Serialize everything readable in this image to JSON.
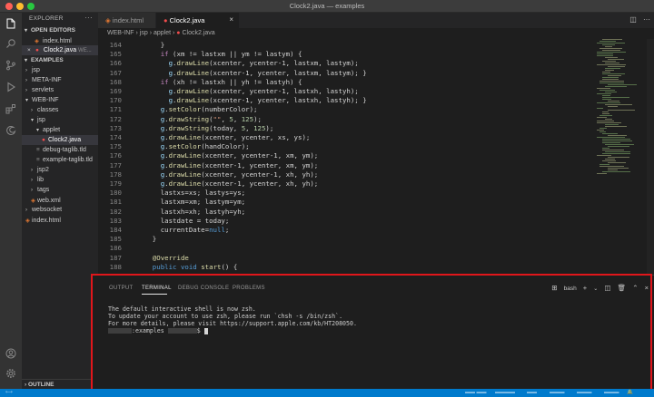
{
  "window": {
    "title": "Clock2.java — examples",
    "traffic_colors": [
      "#ff5f57",
      "#febc2e",
      "#28c840"
    ]
  },
  "sidebar": {
    "header": "EXPLORER",
    "open_editors_label": "OPEN EDITORS",
    "open_editors": [
      {
        "name": "index.html",
        "icon": "html-file-icon"
      },
      {
        "name": "Clock2.java",
        "path": "WE...",
        "icon": "java-file-icon",
        "active": true
      }
    ],
    "workspace_label": "EXAMPLES",
    "tree": [
      {
        "label": "jsp",
        "level": 1,
        "type": "folder",
        "open": false
      },
      {
        "label": "META-INF",
        "level": 1,
        "type": "folder",
        "open": false
      },
      {
        "label": "servlets",
        "level": 1,
        "type": "folder",
        "open": false
      },
      {
        "label": "WEB-INF",
        "level": 1,
        "type": "folder",
        "open": true
      },
      {
        "label": "classes",
        "level": 2,
        "type": "folder",
        "open": false
      },
      {
        "label": "jsp",
        "level": 2,
        "type": "folder",
        "open": true
      },
      {
        "label": "applet",
        "level": 3,
        "type": "folder",
        "open": true
      },
      {
        "label": "Clock2.java",
        "level": 4,
        "type": "java",
        "selected": true
      },
      {
        "label": "debug-taglib.tld",
        "level": 3,
        "type": "tld"
      },
      {
        "label": "example-taglib.tld",
        "level": 3,
        "type": "tld"
      },
      {
        "label": "jsp2",
        "level": 2,
        "type": "folder",
        "open": false
      },
      {
        "label": "lib",
        "level": 2,
        "type": "folder",
        "open": false
      },
      {
        "label": "tags",
        "level": 2,
        "type": "folder",
        "open": false
      },
      {
        "label": "web.xml",
        "level": 2,
        "type": "xml"
      },
      {
        "label": "websocket",
        "level": 1,
        "type": "folder",
        "open": false
      },
      {
        "label": "index.html",
        "level": 1,
        "type": "html"
      }
    ],
    "outline_label": "OUTLINE"
  },
  "tabs": [
    {
      "label": "index.html",
      "icon": "html-file-icon",
      "active": false
    },
    {
      "label": "Clock2.java",
      "icon": "java-file-icon",
      "active": true
    }
  ],
  "breadcrumb": [
    "WEB-INF",
    "jsp",
    "applet",
    "Clock2.java"
  ],
  "editor": {
    "lines": [
      {
        "n": "164",
        "indent": 6,
        "tokens": [
          [
            "p",
            "}"
          ]
        ]
      },
      {
        "n": "165",
        "indent": 6,
        "tokens": [
          [
            "kw",
            "if"
          ],
          [
            "p",
            " (xm != lastxm || ym != lastym) {"
          ]
        ]
      },
      {
        "n": "166",
        "indent": 8,
        "tokens": [
          [
            "v",
            "g"
          ],
          [
            "p",
            "."
          ],
          [
            "fn",
            "drawLine"
          ],
          [
            "p",
            "(xcenter, ycenter-1, lastxm, lastym);"
          ]
        ]
      },
      {
        "n": "167",
        "indent": 8,
        "tokens": [
          [
            "v",
            "g"
          ],
          [
            "p",
            "."
          ],
          [
            "fn",
            "drawLine"
          ],
          [
            "p",
            "(xcenter-1, ycenter, lastxm, lastym); }"
          ]
        ]
      },
      {
        "n": "168",
        "indent": 6,
        "tokens": [
          [
            "kw",
            "if"
          ],
          [
            "p",
            " (xh != lastxh || yh != lastyh) {"
          ]
        ]
      },
      {
        "n": "169",
        "indent": 8,
        "tokens": [
          [
            "v",
            "g"
          ],
          [
            "p",
            "."
          ],
          [
            "fn",
            "drawLine"
          ],
          [
            "p",
            "(xcenter, ycenter-1, lastxh, lastyh);"
          ]
        ]
      },
      {
        "n": "170",
        "indent": 8,
        "tokens": [
          [
            "v",
            "g"
          ],
          [
            "p",
            "."
          ],
          [
            "fn",
            "drawLine"
          ],
          [
            "p",
            "(xcenter-1, ycenter, lastxh, lastyh); }"
          ]
        ]
      },
      {
        "n": "171",
        "indent": 6,
        "tokens": [
          [
            "v",
            "g"
          ],
          [
            "p",
            "."
          ],
          [
            "fn",
            "setColor"
          ],
          [
            "p",
            "(numberColor);"
          ]
        ]
      },
      {
        "n": "172",
        "indent": 6,
        "tokens": [
          [
            "v",
            "g"
          ],
          [
            "p",
            "."
          ],
          [
            "fn",
            "drawString"
          ],
          [
            "p",
            "("
          ],
          [
            "s",
            "\"\""
          ],
          [
            "p",
            ", "
          ],
          [
            "num",
            "5"
          ],
          [
            "p",
            ", "
          ],
          [
            "num",
            "125"
          ],
          [
            "p",
            ");"
          ]
        ]
      },
      {
        "n": "173",
        "indent": 6,
        "tokens": [
          [
            "v",
            "g"
          ],
          [
            "p",
            "."
          ],
          [
            "fn",
            "drawString"
          ],
          [
            "p",
            "(today, "
          ],
          [
            "num",
            "5"
          ],
          [
            "p",
            ", "
          ],
          [
            "num",
            "125"
          ],
          [
            "p",
            ");"
          ]
        ]
      },
      {
        "n": "174",
        "indent": 6,
        "tokens": [
          [
            "v",
            "g"
          ],
          [
            "p",
            "."
          ],
          [
            "fn",
            "drawLine"
          ],
          [
            "p",
            "(xcenter, ycenter, xs, ys);"
          ]
        ]
      },
      {
        "n": "175",
        "indent": 6,
        "tokens": [
          [
            "v",
            "g"
          ],
          [
            "p",
            "."
          ],
          [
            "fn",
            "setColor"
          ],
          [
            "p",
            "(handColor);"
          ]
        ]
      },
      {
        "n": "176",
        "indent": 6,
        "tokens": [
          [
            "v",
            "g"
          ],
          [
            "p",
            "."
          ],
          [
            "fn",
            "drawLine"
          ],
          [
            "p",
            "(xcenter, ycenter-1, xm, ym);"
          ]
        ]
      },
      {
        "n": "177",
        "indent": 6,
        "tokens": [
          [
            "v",
            "g"
          ],
          [
            "p",
            "."
          ],
          [
            "fn",
            "drawLine"
          ],
          [
            "p",
            "(xcenter-1, ycenter, xm, ym);"
          ]
        ]
      },
      {
        "n": "178",
        "indent": 6,
        "tokens": [
          [
            "v",
            "g"
          ],
          [
            "p",
            "."
          ],
          [
            "fn",
            "drawLine"
          ],
          [
            "p",
            "(xcenter, ycenter-1, xh, yh);"
          ]
        ]
      },
      {
        "n": "179",
        "indent": 6,
        "tokens": [
          [
            "v",
            "g"
          ],
          [
            "p",
            "."
          ],
          [
            "fn",
            "drawLine"
          ],
          [
            "p",
            "(xcenter-1, ycenter, xh, yh);"
          ]
        ]
      },
      {
        "n": "180",
        "indent": 6,
        "tokens": [
          [
            "p",
            "lastxs=xs; lastys=ys;"
          ]
        ]
      },
      {
        "n": "181",
        "indent": 6,
        "tokens": [
          [
            "p",
            "lastxm=xm; lastym=ym;"
          ]
        ]
      },
      {
        "n": "182",
        "indent": 6,
        "tokens": [
          [
            "p",
            "lastxh=xh; lastyh=yh;"
          ]
        ]
      },
      {
        "n": "183",
        "indent": 6,
        "tokens": [
          [
            "p",
            "lastdate = today;"
          ]
        ]
      },
      {
        "n": "184",
        "indent": 6,
        "tokens": [
          [
            "p",
            "currentDate="
          ],
          [
            "kw2",
            "null"
          ],
          [
            "p",
            ";"
          ]
        ]
      },
      {
        "n": "185",
        "indent": 4,
        "tokens": [
          [
            "p",
            "}"
          ]
        ]
      },
      {
        "n": "186",
        "indent": 0,
        "tokens": []
      },
      {
        "n": "187",
        "indent": 4,
        "tokens": [
          [
            "ann",
            "@Override"
          ]
        ]
      },
      {
        "n": "188",
        "indent": 4,
        "tokens": [
          [
            "kw2",
            "public"
          ],
          [
            "p",
            " "
          ],
          [
            "kw2",
            "void"
          ],
          [
            "p",
            " "
          ],
          [
            "fn",
            "start"
          ],
          [
            "p",
            "() {"
          ]
        ]
      }
    ]
  },
  "panel": {
    "tabs": [
      "OUTPUT",
      "TERMINAL",
      "DEBUG CONSOLE",
      "PROBLEMS"
    ],
    "active_tab": "TERMINAL",
    "shell": "bash",
    "terminal_lines": [
      "The default interactive shell is now zsh.",
      "To update your account to use zsh, please run `chsh -s /bin/zsh`.",
      "For more details, please visit https://support.apple.com/kb/HT208050."
    ],
    "prompt_dir": ":examples",
    "prompt_suffix": "$"
  },
  "colors": {
    "accent": "#007acc",
    "highlight_box": "#e0161b",
    "java_icon": "#f14c4c",
    "html_icon": "#e37933"
  }
}
